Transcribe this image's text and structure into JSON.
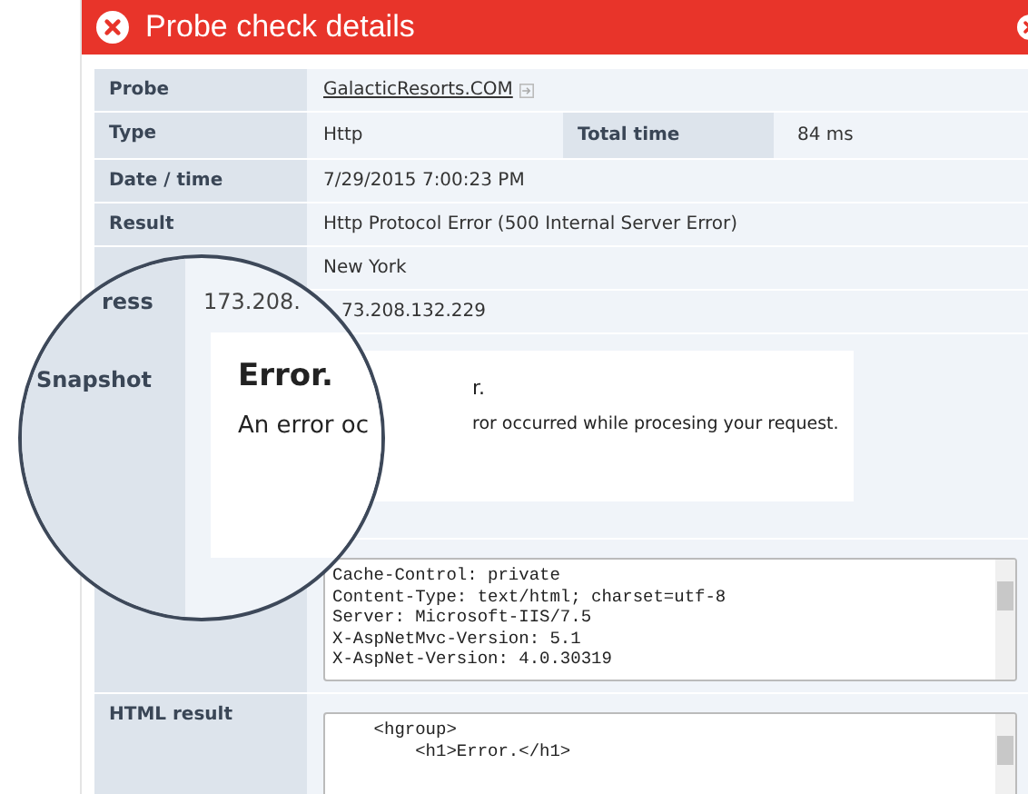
{
  "header": {
    "title": "Probe check details"
  },
  "rows": [
    {
      "kind": "link",
      "label": "Probe",
      "value": "GalacticResorts.COM"
    },
    {
      "kind": "pair",
      "label": "Type",
      "value": "Http",
      "extra_label": "Total time",
      "extra_value": "84 ms"
    },
    {
      "kind": "text",
      "label": "Date / time",
      "value": "7/29/2015 7:00:23 PM"
    },
    {
      "kind": "text",
      "label": "Result",
      "value": "Http Protocol Error (500 Internal Server Error)"
    },
    {
      "kind": "text",
      "value": "New York"
    },
    {
      "kind": "text",
      "value": "73.208.132.229"
    },
    {
      "kind": "snapshot",
      "heading": "r.",
      "text": "ror occurred while procesing your request."
    },
    {
      "kind": "code",
      "lines": [
        "Cache-Control: private",
        "Content-Type: text/html; charset=utf-8",
        "Server: Microsoft-IIS/7.5",
        "X-AspNetMvc-Version: 5.1",
        "X-AspNet-Version: 4.0.30319"
      ]
    },
    {
      "kind": "code",
      "label": "HTML result",
      "lines": [
        "    <hgroup>",
        "        <h1>Error.</h1>"
      ]
    }
  ],
  "lens": {
    "label": "ress",
    "value": "173.208.",
    "section_label": "Snapshot",
    "heading": "Error.",
    "text": "An error oc"
  }
}
